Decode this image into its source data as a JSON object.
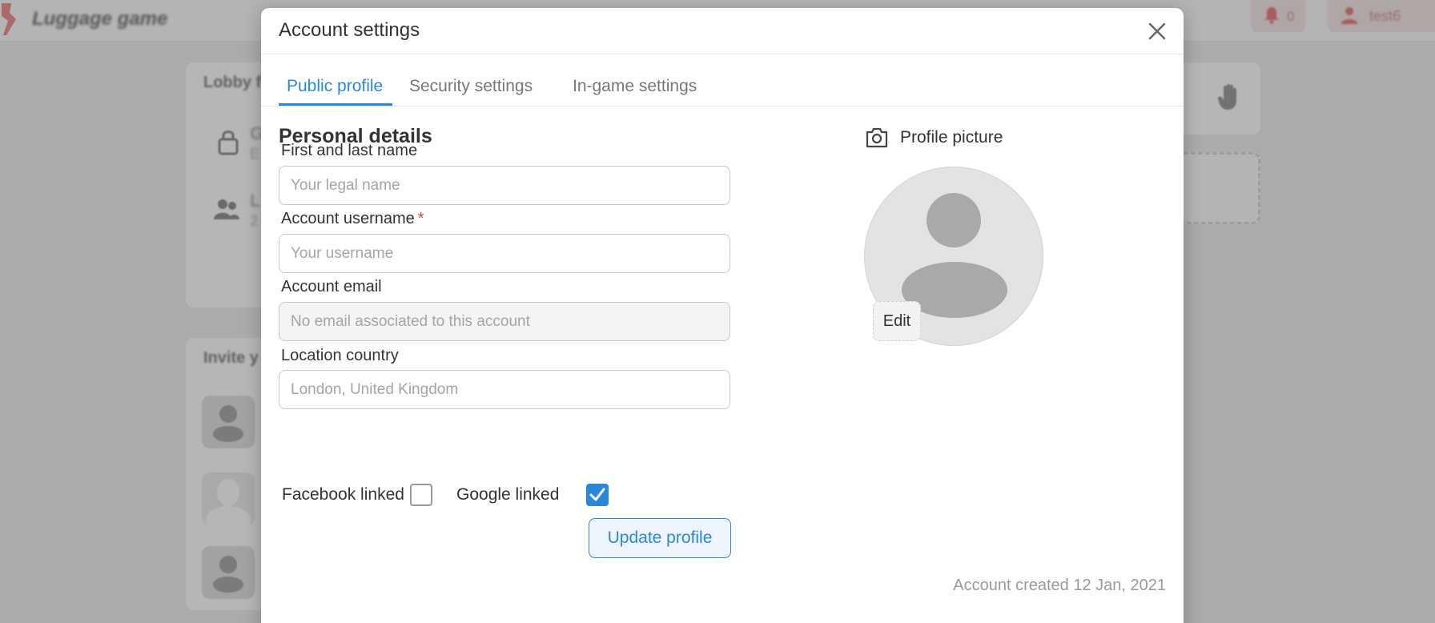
{
  "app": {
    "title": "Luggage game",
    "notification_count": "0",
    "username": "test6"
  },
  "background": {
    "lobby_title": "Lobby f",
    "invite_title": "Invite y",
    "lobby_item_1_letter": "G",
    "lobby_item_1_sub": "E",
    "lobby_item_2_letter": "L",
    "lobby_item_2_sub": "2"
  },
  "modal": {
    "title": "Account settings",
    "tabs": [
      {
        "label": "Public profile",
        "active": true
      },
      {
        "label": "Security settings",
        "active": false
      },
      {
        "label": "In-game settings",
        "active": false
      }
    ],
    "section_title": "Personal details",
    "fields": {
      "name": {
        "label": "First and last name",
        "placeholder": "Your legal name",
        "value": ""
      },
      "username": {
        "label": "Account username",
        "required_mark": "*",
        "placeholder": "Your username",
        "value": ""
      },
      "email": {
        "label": "Account email",
        "placeholder": "No email associated to this account",
        "value": ""
      },
      "country": {
        "label": "Location country",
        "placeholder": "London, United Kingdom",
        "value": ""
      }
    },
    "links": {
      "facebook": {
        "label": "Facebook linked",
        "checked": false
      },
      "google": {
        "label": "Google linked",
        "checked": true
      }
    },
    "update_button": "Update profile",
    "profile_picture": {
      "label": "Profile picture",
      "edit_button": "Edit"
    },
    "account_created": "Account created 12 Jan, 2021"
  },
  "colors": {
    "accent": "#2a88d8",
    "required": "#e04040",
    "muted": "#9a9a9a"
  },
  "icons": [
    "luggage-logo-icon",
    "bell-icon",
    "user-icon",
    "lock-icon",
    "users-icon",
    "hand-icon",
    "close-icon",
    "camera-icon",
    "checkmark-icon"
  ]
}
